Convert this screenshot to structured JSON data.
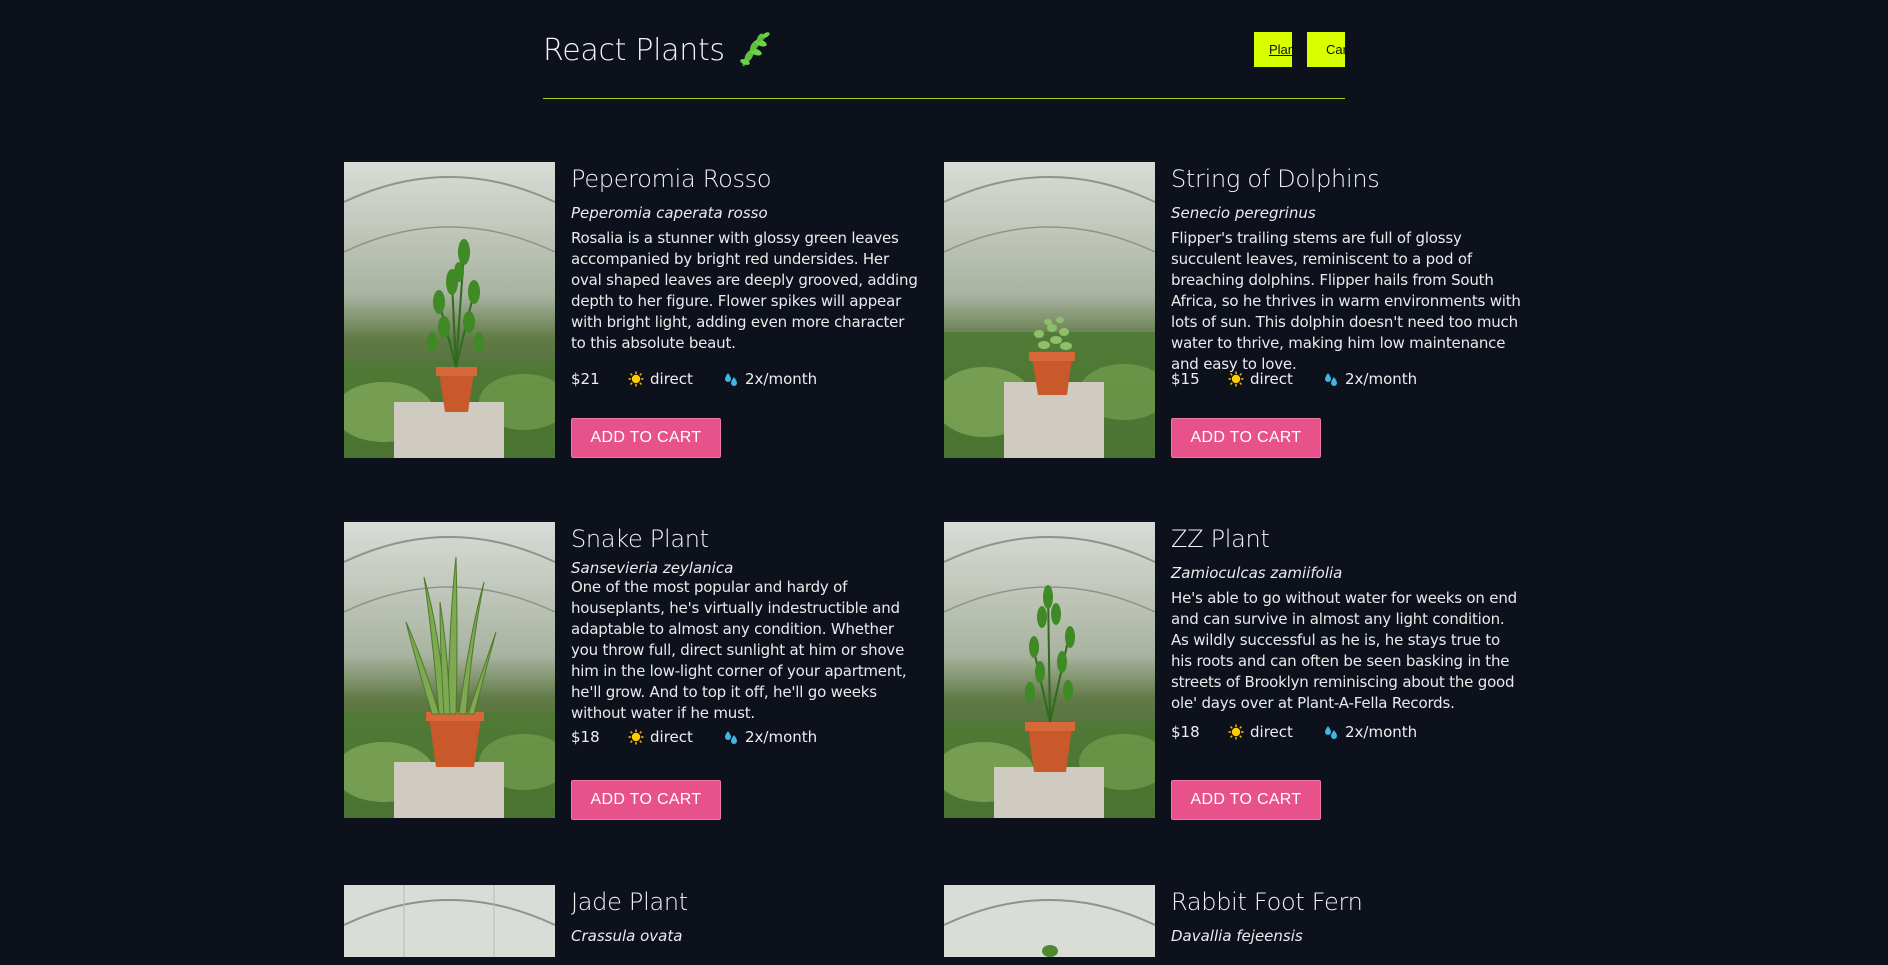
{
  "header": {
    "title": "React Plants",
    "nav": {
      "plants_label": "Plants",
      "cart_label": "Cart"
    }
  },
  "plants": [
    {
      "name": "Peperomia Rosso",
      "scientific": "Peperomia caperata rosso",
      "description": "Rosalia is a stunner with glossy green leaves accompanied by bright red undersides. Her oval shaped leaves are deeply grooved, adding depth to her figure. Flower spikes will appear with bright light, adding even more character to this absolute beaut.",
      "price": "$21",
      "light": "direct",
      "water": "2x/month",
      "button": "ADD TO CART"
    },
    {
      "name": "String of Dolphins",
      "scientific": "Senecio peregrinus",
      "description": "Flipper's trailing stems are full of glossy succulent leaves, reminiscent to a pod of breaching dolphins. Flipper hails from South Africa, so he thrives in warm environments with lots of sun. This dolphin doesn't need too much water to thrive, making him low maintenance and easy to love.",
      "price": "$15",
      "light": "direct",
      "water": "2x/month",
      "button": "ADD TO CART"
    },
    {
      "name": "Snake Plant",
      "scientific": "Sansevieria zeylanica",
      "description": "One of the most popular and hardy of houseplants, he's virtually indestructible and adaptable to almost any condition. Whether you throw full, direct sunlight at him or shove him in the low-light corner of your apartment, he'll grow. And to top it off, he'll go weeks without water if he must.",
      "price": "$18",
      "light": "direct",
      "water": "2x/month",
      "button": "ADD TO CART"
    },
    {
      "name": "ZZ Plant",
      "scientific": "Zamioculcas zamiifolia",
      "description": "He's able to go without water for weeks on end and can survive in almost any light condition. As wildly successful as he is, he stays true to his roots and can often be seen basking in the streets of Brooklyn reminiscing about the good ole' days over at Plant-A-Fella Records.",
      "price": "$18",
      "light": "direct",
      "water": "2x/month",
      "button": "ADD TO CART"
    },
    {
      "name": "Jade Plant",
      "scientific": "Crassula ovata"
    },
    {
      "name": "Rabbit Foot Fern",
      "scientific": "Davallia fejeensis"
    }
  ],
  "colors": {
    "background": "#0d111c",
    "accent": "#d7ff00",
    "divider": "#a4d11a",
    "button": "#e8528a"
  },
  "icons": {
    "brand": "herb-icon",
    "light": "sun-icon",
    "water": "water-drops-icon"
  }
}
